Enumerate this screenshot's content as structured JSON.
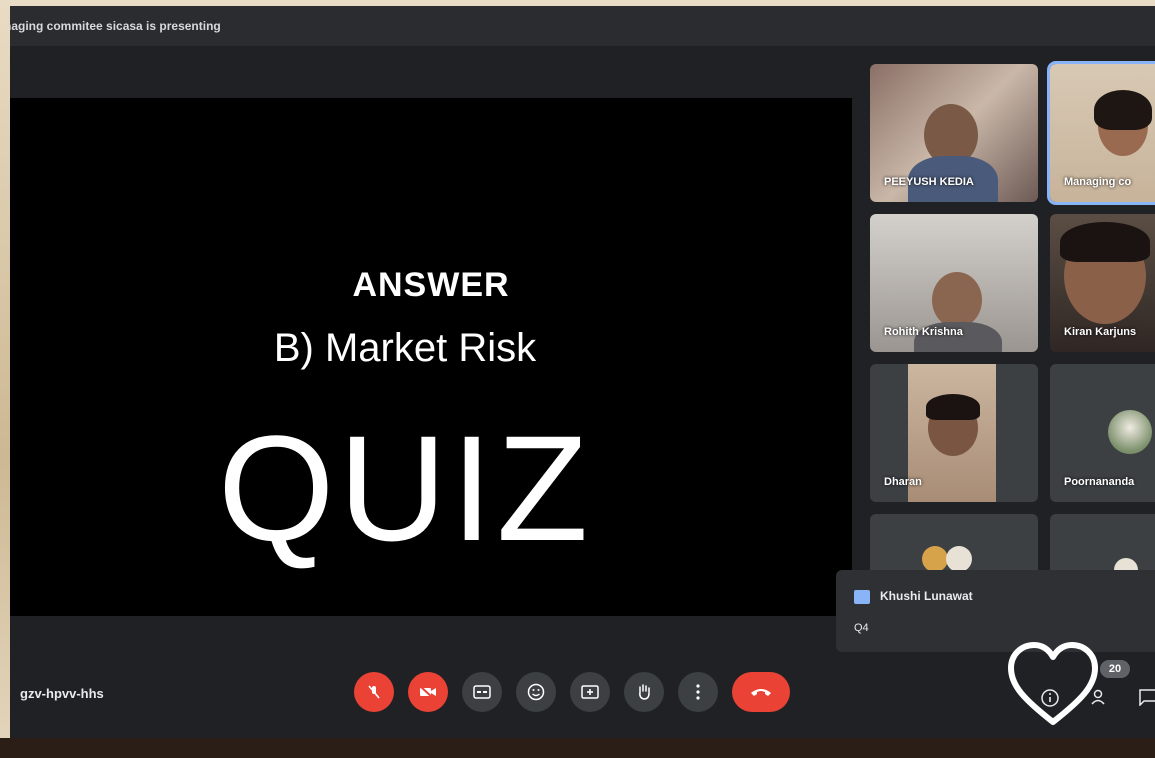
{
  "presenter_banner": "naging commitee sicasa is presenting",
  "slide": {
    "answer_heading": "ANSWER",
    "answer_choice": "B) Market Risk",
    "title": "QUIZ"
  },
  "participants": [
    {
      "name": "PEEYUSH KEDIA"
    },
    {
      "name": "Managing co"
    },
    {
      "name": "Rohith Krishna"
    },
    {
      "name": "Kiran Karjuns"
    },
    {
      "name": "Dharan"
    },
    {
      "name": "Poornananda"
    }
  ],
  "chat_notification": {
    "sender": "Khushi Lunawat",
    "message": "Q4"
  },
  "meeting_code": "gzv-hpvv-hhs",
  "participant_count": "20",
  "colors": {
    "end_call": "#ea4335",
    "active_tile_border": "#8ab4f8",
    "background": "#202124"
  },
  "controls": [
    {
      "icon": "mic-off-icon"
    },
    {
      "icon": "camera-off-icon"
    },
    {
      "icon": "captions-icon"
    },
    {
      "icon": "emoji-icon"
    },
    {
      "icon": "present-icon"
    },
    {
      "icon": "raise-hand-icon"
    },
    {
      "icon": "more-options-icon"
    },
    {
      "icon": "end-call-icon"
    }
  ]
}
